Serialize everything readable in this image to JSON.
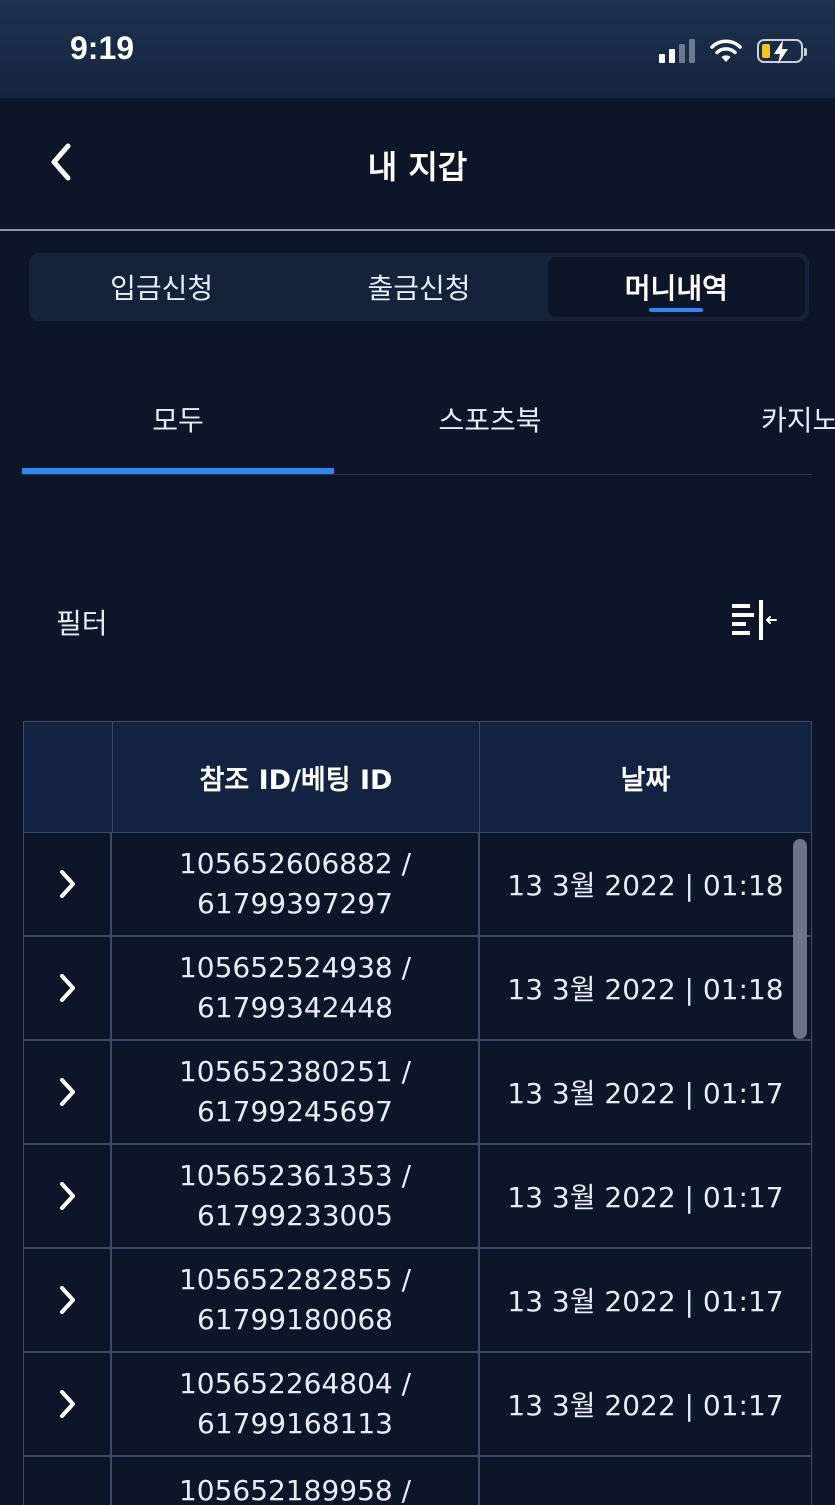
{
  "status_bar": {
    "time": "9:19"
  },
  "header": {
    "title": "내 지갑"
  },
  "segment_tabs": [
    {
      "label": "입금신청",
      "active": false
    },
    {
      "label": "출금신청",
      "active": false
    },
    {
      "label": "머니내역",
      "active": true
    }
  ],
  "category_tabs": [
    {
      "label": "모두",
      "active": true
    },
    {
      "label": "스포츠북",
      "active": false
    },
    {
      "label": "카지노",
      "active": false
    }
  ],
  "filter": {
    "label": "필터",
    "icon": "sort-filter-icon"
  },
  "table": {
    "headers": [
      "",
      "참조 ID/베팅 ID",
      "날짜"
    ],
    "rows": [
      {
        "ref_id": "105652606882 /",
        "bet_id": "61799397297",
        "date": "13 3월 2022 | 01:18"
      },
      {
        "ref_id": "105652524938 /",
        "bet_id": "61799342448",
        "date": "13 3월 2022 | 01:18"
      },
      {
        "ref_id": "105652380251 /",
        "bet_id": "61799245697",
        "date": "13 3월 2022 | 01:17"
      },
      {
        "ref_id": "105652361353 /",
        "bet_id": "61799233005",
        "date": "13 3월 2022 | 01:17"
      },
      {
        "ref_id": "105652282855 /",
        "bet_id": "61799180068",
        "date": "13 3월 2022 | 01:17"
      },
      {
        "ref_id": "105652264804 /",
        "bet_id": "61799168113",
        "date": "13 3월 2022 | 01:17"
      },
      {
        "ref_id": "105652189958 /",
        "bet_id": "",
        "date": ""
      }
    ]
  },
  "colors": {
    "background": "#0c1628",
    "accent": "#2f86f0",
    "header_bg": "#112341",
    "battery": "#f5c518"
  }
}
